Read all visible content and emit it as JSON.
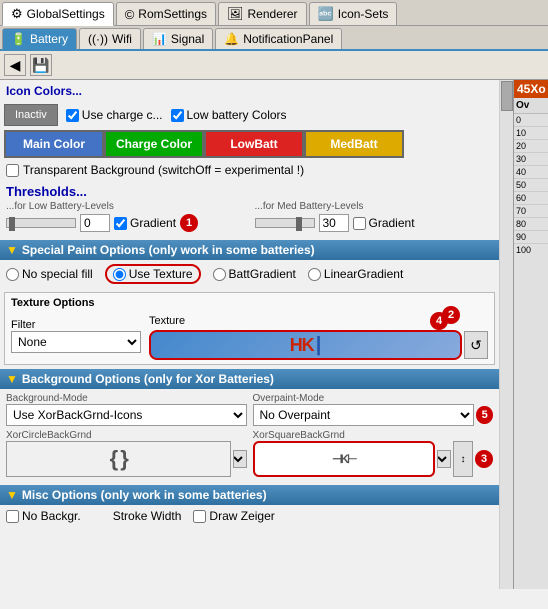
{
  "app": {
    "top_tabs": [
      {
        "label": "GlobalSettings",
        "icon": "⚙"
      },
      {
        "label": "RomSettings",
        "icon": "©"
      },
      {
        "label": "Renderer",
        "icon": "🖼"
      },
      {
        "label": "Icon-Sets",
        "icon": "🔤"
      }
    ],
    "second_tabs": [
      {
        "label": "Battery",
        "icon": "🔋"
      },
      {
        "label": "Wifi",
        "icon": "📶"
      },
      {
        "label": "Signal",
        "icon": "📊"
      },
      {
        "label": "NotificationPanel",
        "icon": "🔔"
      }
    ],
    "active_top_tab": 2,
    "active_second_tab": 0
  },
  "icon_colors": {
    "header": "Icon Colors...",
    "inactiv_label": "Inactiv",
    "use_charge_label": "Use charge c...",
    "low_battery_label": "Low battery Colors",
    "main_color_label": "Main Color",
    "charge_color_label": "Charge Color",
    "lowbatt_label": "LowBatt",
    "medbatt_label": "MedBatt",
    "transparent_bg_label": "Transparent Background (switchOff = experimental !)"
  },
  "thresholds": {
    "title": "Thresholds...",
    "low_subtitle": "...for Low Battery-Levels",
    "med_subtitle": "...for Med Battery-Levels",
    "low_value": "0",
    "med_value": "30",
    "gradient_label": "Gradient",
    "badge1": "1"
  },
  "special_paint": {
    "title": "Special Paint Options (only work in some batteries)",
    "no_special_label": "No special fill",
    "use_texture_label": "Use Texture",
    "batt_gradient_label": "BattGradient",
    "linear_gradient_label": "LinearGradient",
    "texture_options_label": "Texture Options",
    "filter_label": "Filter",
    "filter_value": "None",
    "texture_label": "Texture",
    "badge2": "2",
    "badge4": "4"
  },
  "background_options": {
    "title": "Background Options (only for Xor Batteries)",
    "bg_mode_label": "Background-Mode",
    "bg_mode_value": "Use XorBackGrnd-Icons",
    "overpaint_label": "Overpaint-Mode",
    "overpaint_value": "No Overpaint",
    "xor_circle_label": "XorCircleBackGrnd",
    "xor_square_label": "XorSquareBackGrnd",
    "badge3": "3",
    "badge5": "5"
  },
  "misc_options": {
    "title": "Misc Options (only work in some batteries)",
    "no_bg_label": "No Backgr.",
    "stroke_width_label": "Stroke Width",
    "draw_zeiger_label": "Draw Zeiger"
  },
  "right_panel": {
    "avatar_text": "45",
    "label": "Xo",
    "xorb_label": "XorB",
    "numbers": [
      "0",
      "10",
      "20",
      "30",
      "40",
      "50",
      "60",
      "70",
      "80",
      "90",
      "100"
    ],
    "ov_label": "Ov"
  }
}
